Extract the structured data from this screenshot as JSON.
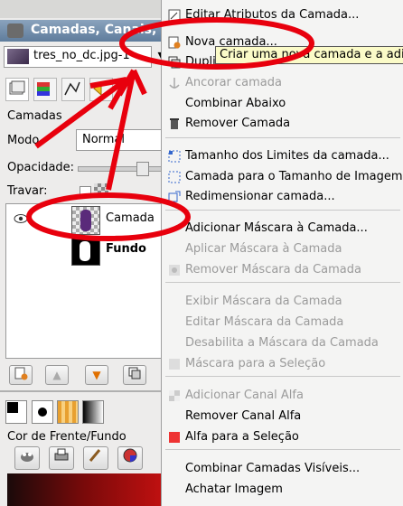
{
  "dock": {
    "window_title": "Camadas, Canais, V",
    "image_selector": "tres_no_dc.jpg-1",
    "panel_label": "Camadas",
    "mode_label": "Modo",
    "mode_value": "Normal",
    "opacity_label": "Opacidade:",
    "lock_label": "Travar:",
    "layers": [
      {
        "name": "Camada"
      },
      {
        "name": "Fundo"
      }
    ],
    "fgbg_label": "Cor de Frente/Fundo"
  },
  "menu": {
    "items": [
      {
        "label": "Editar Atributos da Camada...",
        "icon": "edit-icon",
        "enabled": true
      },
      {
        "label": "Nova camada...",
        "icon": "new-layer-icon",
        "enabled": true
      },
      {
        "label": "Duplicar",
        "icon": "duplicate-icon",
        "enabled": true
      },
      {
        "label": "Ancorar camada",
        "icon": "anchor-icon",
        "enabled": false
      },
      {
        "label": "Combinar Abaixo",
        "icon": "",
        "enabled": true
      },
      {
        "label": "Remover Camada",
        "icon": "trash-icon",
        "enabled": true
      },
      {
        "label": "Tamanho dos Limites da camada...",
        "icon": "resize-icon",
        "enabled": true
      },
      {
        "label": "Camada para o Tamanho de Imagem",
        "icon": "fit-icon",
        "enabled": true
      },
      {
        "label": "Redimensionar camada...",
        "icon": "scale-icon",
        "enabled": true
      },
      {
        "label": "Adicionar Máscara à Camada...",
        "icon": "",
        "enabled": true
      },
      {
        "label": "Aplicar Máscara à Camada",
        "icon": "",
        "enabled": false
      },
      {
        "label": "Remover Máscara da Camada",
        "icon": "mask-icon",
        "enabled": false
      },
      {
        "label": "Exibir Máscara da Camada",
        "icon": "",
        "enabled": false
      },
      {
        "label": "Editar Máscara da Camada",
        "icon": "",
        "enabled": false
      },
      {
        "label": "Desabilita a Máscara da Camada",
        "icon": "",
        "enabled": false
      },
      {
        "label": "Máscara para a Seleção",
        "icon": "mask-select-icon",
        "enabled": false
      },
      {
        "label": "Adicionar Canal Alfa",
        "icon": "alpha-icon",
        "enabled": false
      },
      {
        "label": "Remover Canal Alfa",
        "icon": "",
        "enabled": true
      },
      {
        "label": "Alfa para a Seleção",
        "icon": "alpha-select-icon",
        "enabled": true
      },
      {
        "label": "Combinar Camadas Visíveis...",
        "icon": "",
        "enabled": true
      },
      {
        "label": "Achatar Imagem",
        "icon": "",
        "enabled": true
      }
    ],
    "tooltip": "Criar uma nova camada e a adic"
  },
  "colors": {
    "annotation": "#e8000d",
    "titlebar": "#6f8aa8",
    "tooltip_bg": "#fbfbc8"
  }
}
